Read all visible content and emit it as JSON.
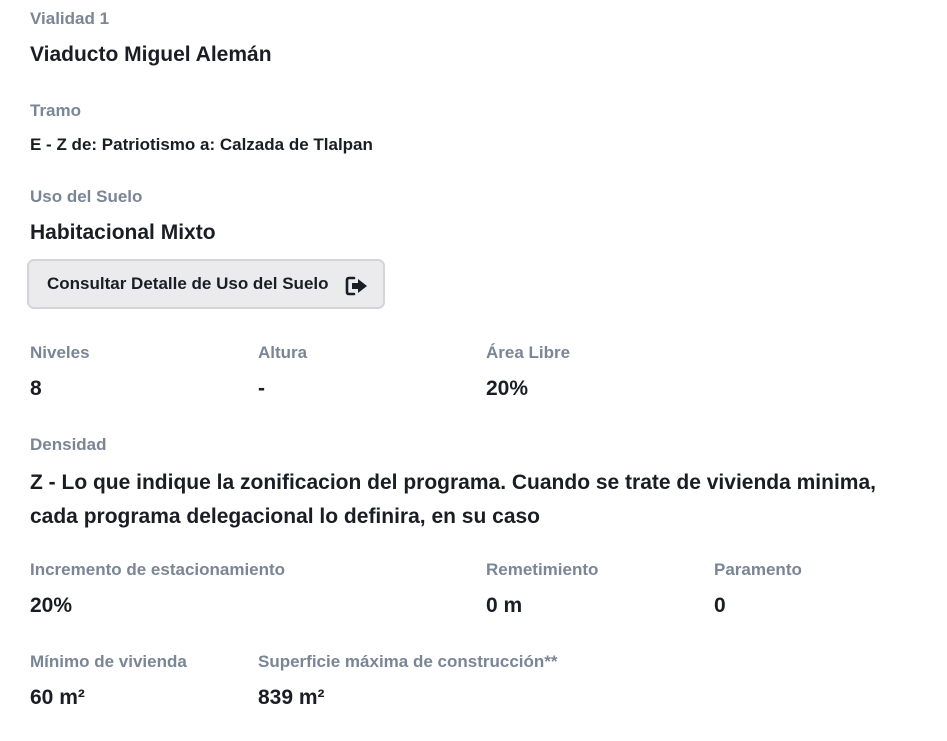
{
  "vialidad": {
    "label": "Vialidad 1",
    "value": "Viaducto Miguel Alemán"
  },
  "tramo": {
    "label": "Tramo",
    "value": "E - Z de: Patriotismo a: Calzada de Tlalpan"
  },
  "uso_suelo": {
    "label": "Uso del Suelo",
    "value": "Habitacional Mixto",
    "button_label": "Consultar Detalle de Uso del Suelo",
    "button_icon": "sign-out-icon"
  },
  "niveles": {
    "label": "Niveles",
    "value": "8"
  },
  "altura": {
    "label": "Altura",
    "value": "-"
  },
  "area_libre": {
    "label": "Área Libre",
    "value": "20%"
  },
  "densidad": {
    "label": "Densidad",
    "value": "Z - Lo que indique la zonificacion del programa. Cuando se trate de vivienda minima, cada programa delegacional lo definira, en su caso"
  },
  "incremento": {
    "label": "Incremento de estacionamiento",
    "value": "20%"
  },
  "remetimiento": {
    "label": "Remetimiento",
    "value": "0 m"
  },
  "paramento": {
    "label": "Paramento",
    "value": "0"
  },
  "minimo_vivienda": {
    "label": "Mínimo de vivienda",
    "value": "60 m²"
  },
  "superficie_maxima": {
    "label": "Superficie máxima de construcción**",
    "value": "839 m²"
  },
  "colors": {
    "label": "#7a8595",
    "value": "#1a1d24",
    "button_bg": "#ebebed",
    "button_border": "#d3d5d9"
  }
}
